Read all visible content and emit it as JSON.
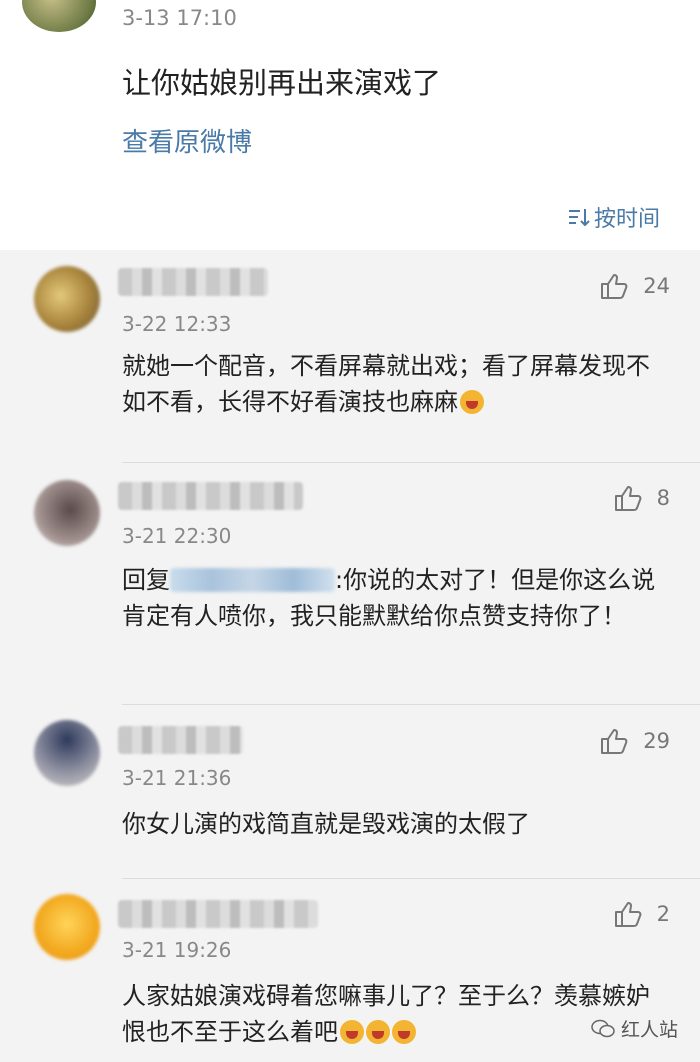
{
  "original_post": {
    "time": "3-13 17:10",
    "text": "让你姑娘别再出来演戏了",
    "view_original": "查看原微博"
  },
  "sort": {
    "label": "按时间"
  },
  "comments": [
    {
      "time": "3-22 12:33",
      "text": "就她一个配音，不看屏幕就出戏；看了屏幕发现不如不看，长得不好看演技也麻麻",
      "likes": "24",
      "emoji_count": 1
    },
    {
      "time": "3-21 22:30",
      "reply_prefix": "回复",
      "text": ":你说的太对了！但是你这么说肯定有人喷你，我只能默默给你点赞支持你了！",
      "likes": "8"
    },
    {
      "time": "3-21 21:36",
      "text": "你女儿演的戏简直就是毁戏演的太假了",
      "likes": "29"
    },
    {
      "time": "3-21 19:26",
      "text": "人家姑娘演戏碍着您嘛事儿了？至于么？羡慕嫉妒恨也不至于这么着吧",
      "likes": "2",
      "emoji_count": 3
    }
  ],
  "watermark": {
    "label": "红人站"
  },
  "colors": {
    "link": "#4a7aa8",
    "background": "#f3f3f3"
  }
}
